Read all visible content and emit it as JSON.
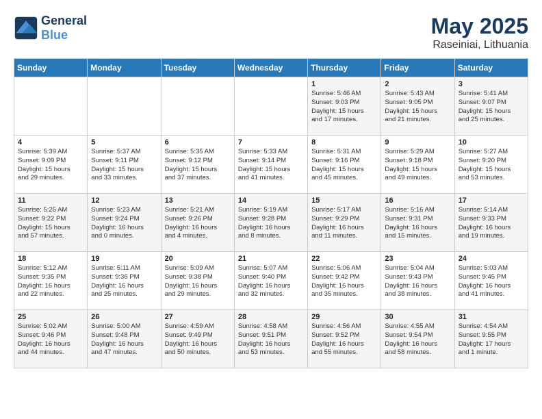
{
  "header": {
    "logo_line1": "General",
    "logo_line2": "Blue",
    "title": "May 2025",
    "subtitle": "Raseiniai, Lithuania"
  },
  "weekdays": [
    "Sunday",
    "Monday",
    "Tuesday",
    "Wednesday",
    "Thursday",
    "Friday",
    "Saturday"
  ],
  "weeks": [
    [
      {
        "day": "",
        "info": ""
      },
      {
        "day": "",
        "info": ""
      },
      {
        "day": "",
        "info": ""
      },
      {
        "day": "",
        "info": ""
      },
      {
        "day": "1",
        "info": "Sunrise: 5:46 AM\nSunset: 9:03 PM\nDaylight: 15 hours\nand 17 minutes."
      },
      {
        "day": "2",
        "info": "Sunrise: 5:43 AM\nSunset: 9:05 PM\nDaylight: 15 hours\nand 21 minutes."
      },
      {
        "day": "3",
        "info": "Sunrise: 5:41 AM\nSunset: 9:07 PM\nDaylight: 15 hours\nand 25 minutes."
      }
    ],
    [
      {
        "day": "4",
        "info": "Sunrise: 5:39 AM\nSunset: 9:09 PM\nDaylight: 15 hours\nand 29 minutes."
      },
      {
        "day": "5",
        "info": "Sunrise: 5:37 AM\nSunset: 9:11 PM\nDaylight: 15 hours\nand 33 minutes."
      },
      {
        "day": "6",
        "info": "Sunrise: 5:35 AM\nSunset: 9:12 PM\nDaylight: 15 hours\nand 37 minutes."
      },
      {
        "day": "7",
        "info": "Sunrise: 5:33 AM\nSunset: 9:14 PM\nDaylight: 15 hours\nand 41 minutes."
      },
      {
        "day": "8",
        "info": "Sunrise: 5:31 AM\nSunset: 9:16 PM\nDaylight: 15 hours\nand 45 minutes."
      },
      {
        "day": "9",
        "info": "Sunrise: 5:29 AM\nSunset: 9:18 PM\nDaylight: 15 hours\nand 49 minutes."
      },
      {
        "day": "10",
        "info": "Sunrise: 5:27 AM\nSunset: 9:20 PM\nDaylight: 15 hours\nand 53 minutes."
      }
    ],
    [
      {
        "day": "11",
        "info": "Sunrise: 5:25 AM\nSunset: 9:22 PM\nDaylight: 15 hours\nand 57 minutes."
      },
      {
        "day": "12",
        "info": "Sunrise: 5:23 AM\nSunset: 9:24 PM\nDaylight: 16 hours\nand 0 minutes."
      },
      {
        "day": "13",
        "info": "Sunrise: 5:21 AM\nSunset: 9:26 PM\nDaylight: 16 hours\nand 4 minutes."
      },
      {
        "day": "14",
        "info": "Sunrise: 5:19 AM\nSunset: 9:28 PM\nDaylight: 16 hours\nand 8 minutes."
      },
      {
        "day": "15",
        "info": "Sunrise: 5:17 AM\nSunset: 9:29 PM\nDaylight: 16 hours\nand 11 minutes."
      },
      {
        "day": "16",
        "info": "Sunrise: 5:16 AM\nSunset: 9:31 PM\nDaylight: 16 hours\nand 15 minutes."
      },
      {
        "day": "17",
        "info": "Sunrise: 5:14 AM\nSunset: 9:33 PM\nDaylight: 16 hours\nand 19 minutes."
      }
    ],
    [
      {
        "day": "18",
        "info": "Sunrise: 5:12 AM\nSunset: 9:35 PM\nDaylight: 16 hours\nand 22 minutes."
      },
      {
        "day": "19",
        "info": "Sunrise: 5:11 AM\nSunset: 9:36 PM\nDaylight: 16 hours\nand 25 minutes."
      },
      {
        "day": "20",
        "info": "Sunrise: 5:09 AM\nSunset: 9:38 PM\nDaylight: 16 hours\nand 29 minutes."
      },
      {
        "day": "21",
        "info": "Sunrise: 5:07 AM\nSunset: 9:40 PM\nDaylight: 16 hours\nand 32 minutes."
      },
      {
        "day": "22",
        "info": "Sunrise: 5:06 AM\nSunset: 9:42 PM\nDaylight: 16 hours\nand 35 minutes."
      },
      {
        "day": "23",
        "info": "Sunrise: 5:04 AM\nSunset: 9:43 PM\nDaylight: 16 hours\nand 38 minutes."
      },
      {
        "day": "24",
        "info": "Sunrise: 5:03 AM\nSunset: 9:45 PM\nDaylight: 16 hours\nand 41 minutes."
      }
    ],
    [
      {
        "day": "25",
        "info": "Sunrise: 5:02 AM\nSunset: 9:46 PM\nDaylight: 16 hours\nand 44 minutes."
      },
      {
        "day": "26",
        "info": "Sunrise: 5:00 AM\nSunset: 9:48 PM\nDaylight: 16 hours\nand 47 minutes."
      },
      {
        "day": "27",
        "info": "Sunrise: 4:59 AM\nSunset: 9:49 PM\nDaylight: 16 hours\nand 50 minutes."
      },
      {
        "day": "28",
        "info": "Sunrise: 4:58 AM\nSunset: 9:51 PM\nDaylight: 16 hours\nand 53 minutes."
      },
      {
        "day": "29",
        "info": "Sunrise: 4:56 AM\nSunset: 9:52 PM\nDaylight: 16 hours\nand 55 minutes."
      },
      {
        "day": "30",
        "info": "Sunrise: 4:55 AM\nSunset: 9:54 PM\nDaylight: 16 hours\nand 58 minutes."
      },
      {
        "day": "31",
        "info": "Sunrise: 4:54 AM\nSunset: 9:55 PM\nDaylight: 17 hours\nand 1 minute."
      }
    ]
  ]
}
